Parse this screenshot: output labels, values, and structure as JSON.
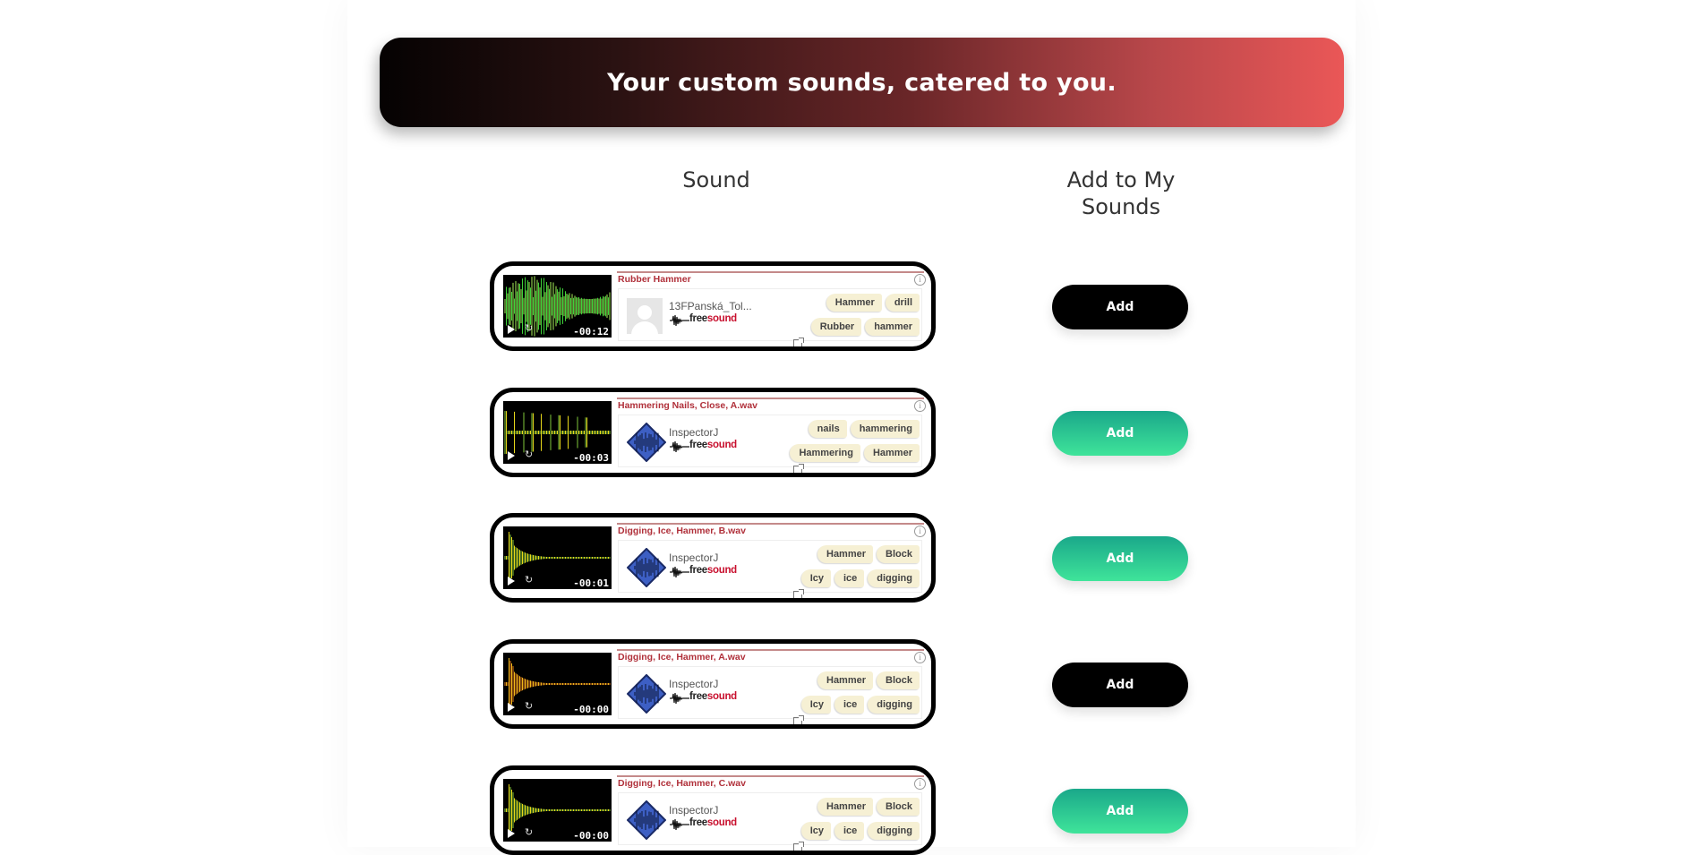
{
  "banner": {
    "title": "Your custom sounds, catered to you."
  },
  "columns": {
    "sound": "Sound",
    "add": "Add to My Sounds"
  },
  "colors": {
    "add_black": "#000000",
    "add_green": "#2ed693",
    "title_red": "#b0303a"
  },
  "sounds": [
    {
      "title": "Rubber Hammer",
      "username": "13FPanská_Tol...",
      "avatar": "default-avatar-icon",
      "duration": "-00:12",
      "wave_color": "green",
      "tags_row1": [
        "Hammer",
        "drill"
      ],
      "tags_row2": [
        "Rubber",
        "hammer"
      ],
      "add_label": "Add",
      "add_style": "black"
    },
    {
      "title": "Hammering Nails, Close, A.wav",
      "username": "InspectorJ",
      "avatar": "diamond-waveform-avatar-icon",
      "duration": "-00:03",
      "wave_color": "yellow",
      "tags_row1": [
        "nails",
        "hammering"
      ],
      "tags_row2": [
        "Hammering",
        "Hammer"
      ],
      "add_label": "Add",
      "add_style": "green"
    },
    {
      "title": "Digging, Ice, Hammer, B.wav",
      "username": "InspectorJ",
      "avatar": "diamond-waveform-avatar-icon",
      "duration": "-00:01",
      "wave_color": "yellow",
      "tags_row1": [
        "Hammer",
        "Block"
      ],
      "tags_row2": [
        "Icy",
        "ice",
        "digging"
      ],
      "add_label": "Add",
      "add_style": "green"
    },
    {
      "title": "Digging, Ice, Hammer, A.wav",
      "username": "InspectorJ",
      "avatar": "diamond-waveform-avatar-icon",
      "duration": "-00:00",
      "wave_color": "orange",
      "tags_row1": [
        "Hammer",
        "Block"
      ],
      "tags_row2": [
        "Icy",
        "ice",
        "digging"
      ],
      "add_label": "Add",
      "add_style": "black"
    },
    {
      "title": "Digging, Ice, Hammer, C.wav",
      "username": "InspectorJ",
      "avatar": "diamond-waveform-avatar-icon",
      "duration": "-00:00",
      "wave_color": "yellow",
      "tags_row1": [
        "Hammer",
        "Block"
      ],
      "tags_row2": [
        "Icy",
        "ice",
        "digging"
      ],
      "add_label": "Add",
      "add_style": "green"
    }
  ]
}
